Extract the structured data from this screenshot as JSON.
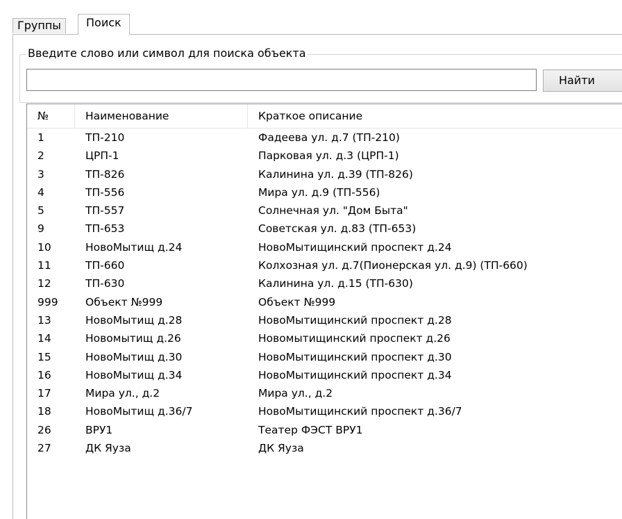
{
  "tabs": [
    {
      "label": "Группы",
      "active": false
    },
    {
      "label": "Поиск",
      "active": true
    }
  ],
  "search": {
    "group_label": "Введите слово или символ для поиска объекта",
    "value": "",
    "button_label": "Найти"
  },
  "table": {
    "columns": [
      "№",
      "Наименование",
      "Краткое описание"
    ],
    "rows": [
      [
        "1",
        "ТП-210",
        "Фадеева ул. д.7 (ТП-210)"
      ],
      [
        "2",
        "ЦРП-1",
        "Парковая ул. д.3 (ЦРП-1)"
      ],
      [
        "3",
        "ТП-826",
        "Калинина ул. д.39 (ТП-826)"
      ],
      [
        "4",
        "ТП-556",
        "Мира ул. д.9 (ТП-556)"
      ],
      [
        "5",
        "ТП-557",
        "Солнечная ул. \"Дом Быта\""
      ],
      [
        "9",
        "ТП-653",
        "Советская ул. д.83 (ТП-653)"
      ],
      [
        "10",
        "НовоМытищ д.24",
        "НовоМытищинский проспект д.24"
      ],
      [
        "11",
        "ТП-660",
        "Колхозная ул. д.7(Пионерская ул. д.9) (ТП-660)"
      ],
      [
        "12",
        "ТП-630",
        "Калинина ул. д.15 (ТП-630)"
      ],
      [
        "999",
        "Объект №999",
        "Объект №999"
      ],
      [
        "13",
        "НовоМытищ д.28",
        "НовоМытищинский проспект д.28"
      ],
      [
        "14",
        "Новомытищ д.26",
        "Новомытищинский проспект д.26"
      ],
      [
        "15",
        "НовоМытищ д.30",
        "НовоМытищинский проспект д.30"
      ],
      [
        "16",
        "НовоМытищ д.34",
        "НовоМытищинский проспект д.34"
      ],
      [
        "17",
        "Мира ул., д.2",
        "Мира ул., д.2"
      ],
      [
        "18",
        "НовоМытищ д.36/7",
        "НовоМытищинский проспект д.36/7"
      ],
      [
        "26",
        "ВРУ1",
        "Театер ФЭСТ ВРУ1"
      ],
      [
        "27",
        "ДК Яуза",
        "ДК Яуза"
      ]
    ]
  }
}
